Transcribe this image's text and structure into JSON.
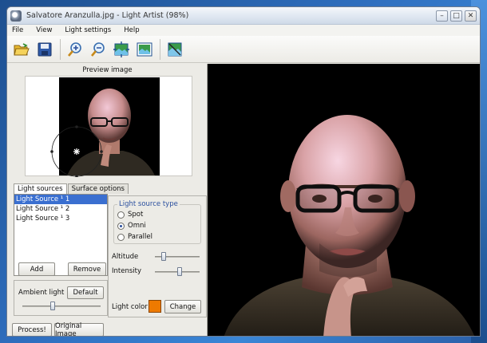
{
  "window": {
    "title": "Salvatore Aranzulla.jpg - Light Artist (98%)",
    "buttons": {
      "minimize": "–",
      "maximize": "□",
      "close": "✕"
    }
  },
  "menu": [
    {
      "label": "File"
    },
    {
      "label": "View"
    },
    {
      "label": "Light settings"
    },
    {
      "label": "Help"
    }
  ],
  "toolbar": {
    "icons": [
      "open-folder-icon",
      "save-icon",
      "zoom-in-icon",
      "zoom-out-icon",
      "fit-window-icon",
      "actual-size-icon",
      "compare-icon"
    ]
  },
  "preview": {
    "title": "Preview image"
  },
  "tabs": [
    {
      "label": "Light sources"
    },
    {
      "label": "Surface options"
    }
  ],
  "light_sources": {
    "items": [
      "Light Source ¹ 1",
      "Light Source ¹ 2",
      "Light Source ¹ 3"
    ],
    "selected": "Light Source ¹ 1",
    "add_label": "Add",
    "remove_label": "Remove"
  },
  "ambient": {
    "label": "Ambient light",
    "default_label": "Default",
    "level": 0.38
  },
  "light_type": {
    "legend": "Light source type",
    "options": [
      "Spot",
      "Omni",
      "Parallel"
    ],
    "selected": "Omni"
  },
  "altitude": {
    "label": "Altitude",
    "level": 0.15
  },
  "intensity": {
    "label": "Intensity",
    "level": 0.55
  },
  "light_color": {
    "label": "Light color",
    "change_label": "Change",
    "color": "#ee7a00"
  },
  "bottom_buttons": {
    "process_label": "Process!",
    "original_label": "Original Image"
  },
  "colors": {
    "selection": "#3a6fd0",
    "accent_legend": "#2a4f9e"
  }
}
